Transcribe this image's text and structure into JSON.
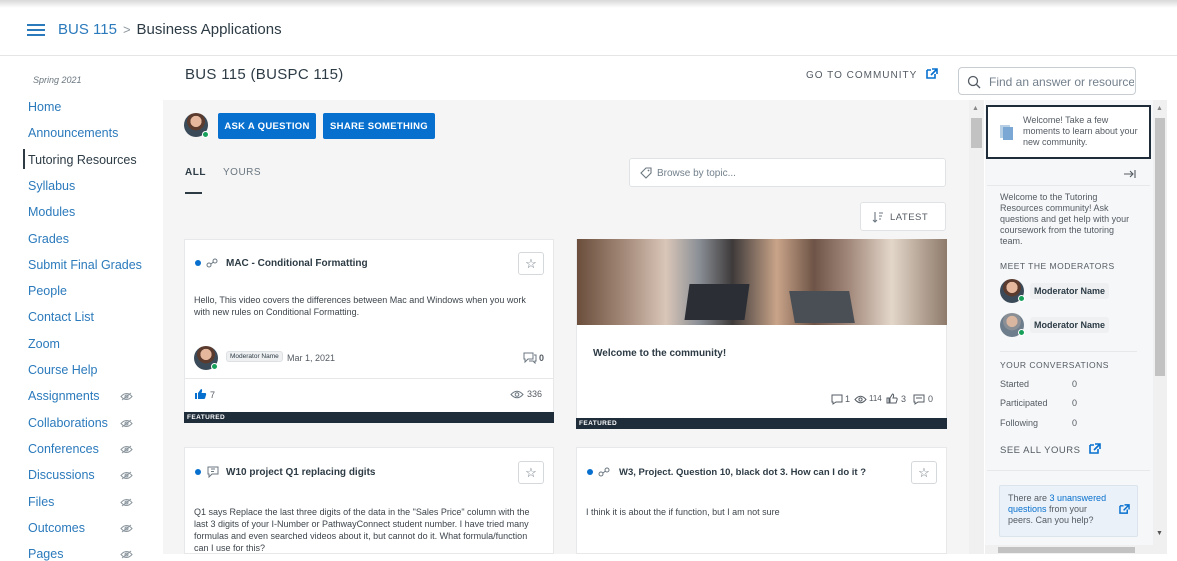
{
  "header": {
    "course_code": "BUS 115",
    "breadcrumb_sep": ">",
    "page": "Business Applications"
  },
  "nav": {
    "term": "Spring 2021",
    "items": [
      {
        "label": "Home",
        "hidden": false
      },
      {
        "label": "Announcements",
        "hidden": false
      },
      {
        "label": "Tutoring Resources",
        "hidden": false,
        "active": true
      },
      {
        "label": "Syllabus",
        "hidden": false
      },
      {
        "label": "Modules",
        "hidden": false
      },
      {
        "label": "Grades",
        "hidden": false
      },
      {
        "label": "Submit Final Grades",
        "hidden": false
      },
      {
        "label": "People",
        "hidden": false
      },
      {
        "label": "Contact List",
        "hidden": false
      },
      {
        "label": "Zoom",
        "hidden": false
      },
      {
        "label": "Course Help",
        "hidden": false
      },
      {
        "label": "Assignments",
        "hidden": true
      },
      {
        "label": "Collaborations",
        "hidden": true
      },
      {
        "label": "Conferences",
        "hidden": true
      },
      {
        "label": "Discussions",
        "hidden": true
      },
      {
        "label": "Files",
        "hidden": true
      },
      {
        "label": "Outcomes",
        "hidden": true
      },
      {
        "label": "Pages",
        "hidden": true
      }
    ]
  },
  "community": {
    "title": "BUS 115 (BUSPC 115)",
    "goto": "GO TO COMMUNITY",
    "search_placeholder": "Find an answer or resource",
    "ask_button": "ASK A QUESTION",
    "share_button": "SHARE SOMETHING",
    "tabs": {
      "all": "ALL",
      "yours": "YOURS"
    },
    "browse_placeholder": "Browse by topic...",
    "sort": "LATEST"
  },
  "cards": {
    "c1": {
      "title": "MAC - Conditional Formatting",
      "body": "Hello, This video covers the differences between Mac and Windows when you work with new rules on Conditional Formatting.",
      "author": "Moderator Name",
      "date": "Mar 1, 2021",
      "comments": "0",
      "likes": "7",
      "views": "336",
      "badge": "FEATURED"
    },
    "c2": {
      "title": "Welcome to the community!",
      "comments": "1",
      "views": "114",
      "likes": "3",
      "replies": "0",
      "badge": "FEATURED"
    },
    "c3": {
      "title": "W10 project Q1 replacing digits",
      "body": "Q1 says Replace the last three digits of the data in the \"Sales Price\" column with the last 3 digits of your I-Number or PathwayConnect student number. I have tried many formulas and even searched videos about it, but cannot do it. What formula/function can I use for this?"
    },
    "c4": {
      "title": "W3, Project. Question 10, black dot 3. How can I do it ?",
      "body": "I think it is about  the if function, but I am not sure"
    }
  },
  "side": {
    "welcome": "Welcome! Take a few moments to learn about your new community.",
    "intro": "Welcome to the Tutoring Resources community! Ask questions and get help with your coursework from the tutoring team.",
    "moderators_head": "MEET THE MODERATORS",
    "mod1": "Moderator Name",
    "mod2": "Moderator Name",
    "conv_head": "YOUR CONVERSATIONS",
    "started_label": "Started",
    "started": "0",
    "participated_label": "Participated",
    "participated": "0",
    "following_label": "Following",
    "following": "0",
    "see_all": "SEE ALL YOURS",
    "unanswered_pre": "There are ",
    "unanswered_link": "3 unanswered questions",
    "unanswered_post": " from your peers. Can you help?"
  },
  "colors": {
    "accent": "#0770cf",
    "link": "#2b7abc",
    "featured": "#1f2c3a"
  }
}
